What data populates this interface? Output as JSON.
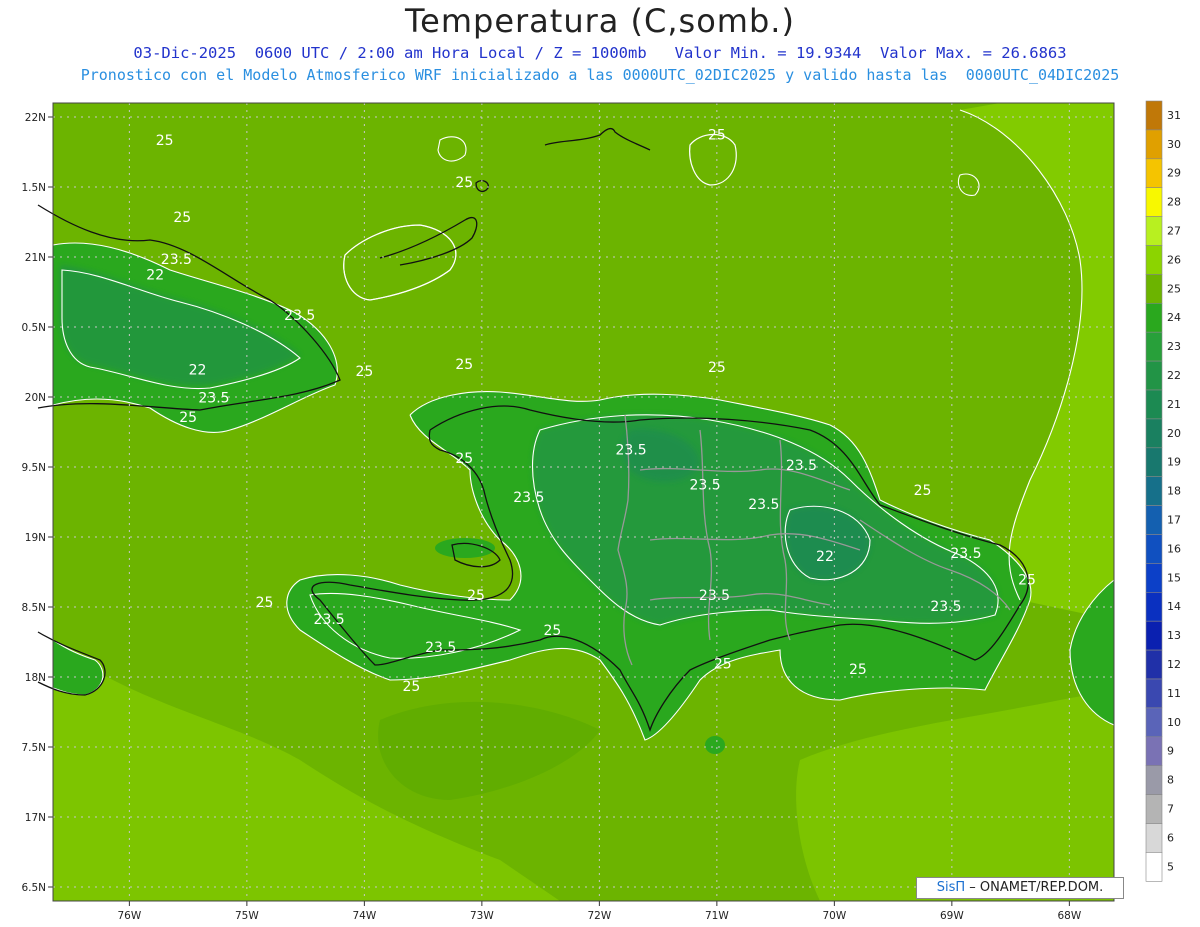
{
  "header": {
    "title": "Temperatura (C,somb.)",
    "line1": "03-Dic-2025  0600 UTC / 2:00 am Hora Local / Z = 1000mb   Valor Min. = 19.9344  Valor Max. = 26.6863",
    "line2": "Pronostico con el Modelo Atmosferico WRF inicializado a las 0000UTC_02DIC2025 y valido hasta las  0000UTC_04DIC2025"
  },
  "axes": {
    "lat_labels": [
      "22N",
      "1.5N",
      "21N",
      "0.5N",
      "20N",
      "9.5N",
      "19N",
      "8.5N",
      "18N",
      "7.5N",
      "17N",
      "6.5N"
    ],
    "lon_labels": [
      "76W",
      "75W",
      "74W",
      "73W",
      "72W",
      "71W",
      "70W",
      "69W",
      "68W"
    ]
  },
  "colorbar": {
    "labels": [
      "31",
      "30",
      "29",
      "28",
      "27",
      "26",
      "25",
      "24",
      "23",
      "22",
      "21",
      "20",
      "19",
      "18",
      "17",
      "16",
      "15",
      "14",
      "13",
      "12",
      "11",
      "10",
      "9",
      "8",
      "7",
      "6",
      "5"
    ],
    "colors": [
      "#c07808",
      "#e0a000",
      "#f5c400",
      "#f8f800",
      "#b8f020",
      "#8cd400",
      "#6cb400",
      "#2aa81e",
      "#28a03a",
      "#229446",
      "#1c8a52",
      "#1a8060",
      "#18786e",
      "#16708a",
      "#1460b0",
      "#1050c0",
      "#0c40c8",
      "#0a30c0",
      "#0a20b0",
      "#2030a8",
      "#3a48b0",
      "#5a64b8",
      "#7a72b4",
      "#9a9aa8",
      "#b4b4b4",
      "#d8d8d8",
      "#ffffff"
    ]
  },
  "contour_labels": [
    {
      "text": "25",
      "lon": -75.7,
      "lat": 21.8
    },
    {
      "text": "25",
      "lon": -75.55,
      "lat": 21.25
    },
    {
      "text": "23.5",
      "lon": -75.6,
      "lat": 20.95
    },
    {
      "text": "22",
      "lon": -75.78,
      "lat": 20.84
    },
    {
      "text": "23.5",
      "lon": -74.55,
      "lat": 20.55
    },
    {
      "text": "22",
      "lon": -75.42,
      "lat": 20.16
    },
    {
      "text": "23.5",
      "lon": -75.28,
      "lat": 19.96
    },
    {
      "text": "25",
      "lon": -75.5,
      "lat": 19.82
    },
    {
      "text": "25",
      "lon": -74.0,
      "lat": 20.15
    },
    {
      "text": "25",
      "lon": -73.15,
      "lat": 21.5
    },
    {
      "text": "25",
      "lon": -71.0,
      "lat": 21.84
    },
    {
      "text": "25",
      "lon": -73.15,
      "lat": 20.2
    },
    {
      "text": "25",
      "lon": -71.0,
      "lat": 20.18
    },
    {
      "text": "25",
      "lon": -73.15,
      "lat": 19.53
    },
    {
      "text": "23.5",
      "lon": -72.6,
      "lat": 19.25
    },
    {
      "text": "23.5",
      "lon": -71.73,
      "lat": 19.59
    },
    {
      "text": "23.5",
      "lon": -71.1,
      "lat": 19.34
    },
    {
      "text": "23.5",
      "lon": -70.28,
      "lat": 19.48
    },
    {
      "text": "23.5",
      "lon": -70.6,
      "lat": 19.2
    },
    {
      "text": "25",
      "lon": -69.25,
      "lat": 19.3
    },
    {
      "text": "22",
      "lon": -70.08,
      "lat": 18.83
    },
    {
      "text": "23.5",
      "lon": -68.88,
      "lat": 18.85
    },
    {
      "text": "25",
      "lon": -68.36,
      "lat": 18.66
    },
    {
      "text": "23.5",
      "lon": -69.05,
      "lat": 18.47
    },
    {
      "text": "23.5",
      "lon": -71.02,
      "lat": 18.55
    },
    {
      "text": "25",
      "lon": -73.05,
      "lat": 18.55
    },
    {
      "text": "25",
      "lon": -74.85,
      "lat": 18.5
    },
    {
      "text": "23.5",
      "lon": -74.3,
      "lat": 18.38
    },
    {
      "text": "23.5",
      "lon": -73.35,
      "lat": 18.18
    },
    {
      "text": "25",
      "lon": -72.4,
      "lat": 18.3
    },
    {
      "text": "25",
      "lon": -70.95,
      "lat": 18.06
    },
    {
      "text": "25",
      "lon": -69.8,
      "lat": 18.02
    },
    {
      "text": "25",
      "lon": -73.6,
      "lat": 17.9
    }
  ],
  "credit": {
    "brand": "SisΠ",
    "text": " – ONAMET/REP.DOM."
  }
}
